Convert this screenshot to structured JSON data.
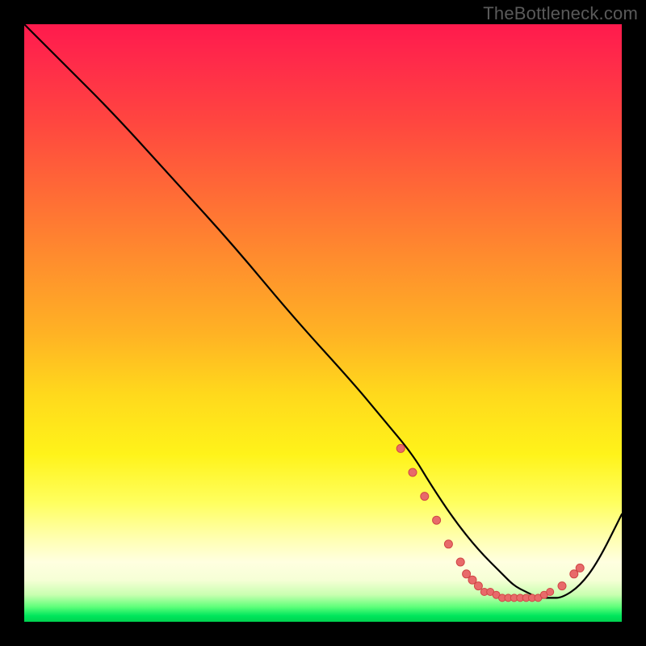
{
  "attribution": "TheBottleneck.com",
  "colors": {
    "background": "#000000",
    "gradient_top": "#ff1a4d",
    "gradient_bottom": "#00d24f",
    "curve": "#000000",
    "marker_fill": "#e86a6a",
    "marker_stroke": "#d04646"
  },
  "chart_data": {
    "type": "line",
    "title": "",
    "xlabel": "",
    "ylabel": "",
    "xlim": [
      0,
      100
    ],
    "ylim": [
      0,
      100
    ],
    "grid": false,
    "legend": false,
    "series": [
      {
        "name": "bottleneck-curve",
        "x": [
          0,
          3,
          7,
          15,
          25,
          35,
          45,
          55,
          60,
          65,
          68,
          72,
          76,
          80,
          82,
          84,
          86,
          88,
          90,
          93,
          96,
          100
        ],
        "y": [
          100,
          97,
          93,
          85,
          74,
          63,
          51,
          40,
          34,
          28,
          23,
          17,
          12,
          8,
          6,
          5,
          4,
          4,
          4,
          6,
          10,
          18
        ]
      }
    ],
    "markers": [
      {
        "x": 63,
        "y": 29
      },
      {
        "x": 65,
        "y": 25
      },
      {
        "x": 67,
        "y": 21
      },
      {
        "x": 69,
        "y": 17
      },
      {
        "x": 71,
        "y": 13
      },
      {
        "x": 73,
        "y": 10
      },
      {
        "x": 74,
        "y": 8
      },
      {
        "x": 75,
        "y": 7
      },
      {
        "x": 76,
        "y": 6
      },
      {
        "x": 77,
        "y": 5
      },
      {
        "x": 78,
        "y": 5
      },
      {
        "x": 79,
        "y": 4.5
      },
      {
        "x": 80,
        "y": 4
      },
      {
        "x": 81,
        "y": 4
      },
      {
        "x": 82,
        "y": 4
      },
      {
        "x": 83,
        "y": 4
      },
      {
        "x": 84,
        "y": 4
      },
      {
        "x": 85,
        "y": 4
      },
      {
        "x": 86,
        "y": 4
      },
      {
        "x": 87,
        "y": 4.5
      },
      {
        "x": 88,
        "y": 5
      },
      {
        "x": 90,
        "y": 6
      },
      {
        "x": 92,
        "y": 8
      },
      {
        "x": 93,
        "y": 9
      }
    ],
    "marker_radius_px": 5,
    "dense_marker_radius_px": 4.5,
    "annotations": []
  }
}
